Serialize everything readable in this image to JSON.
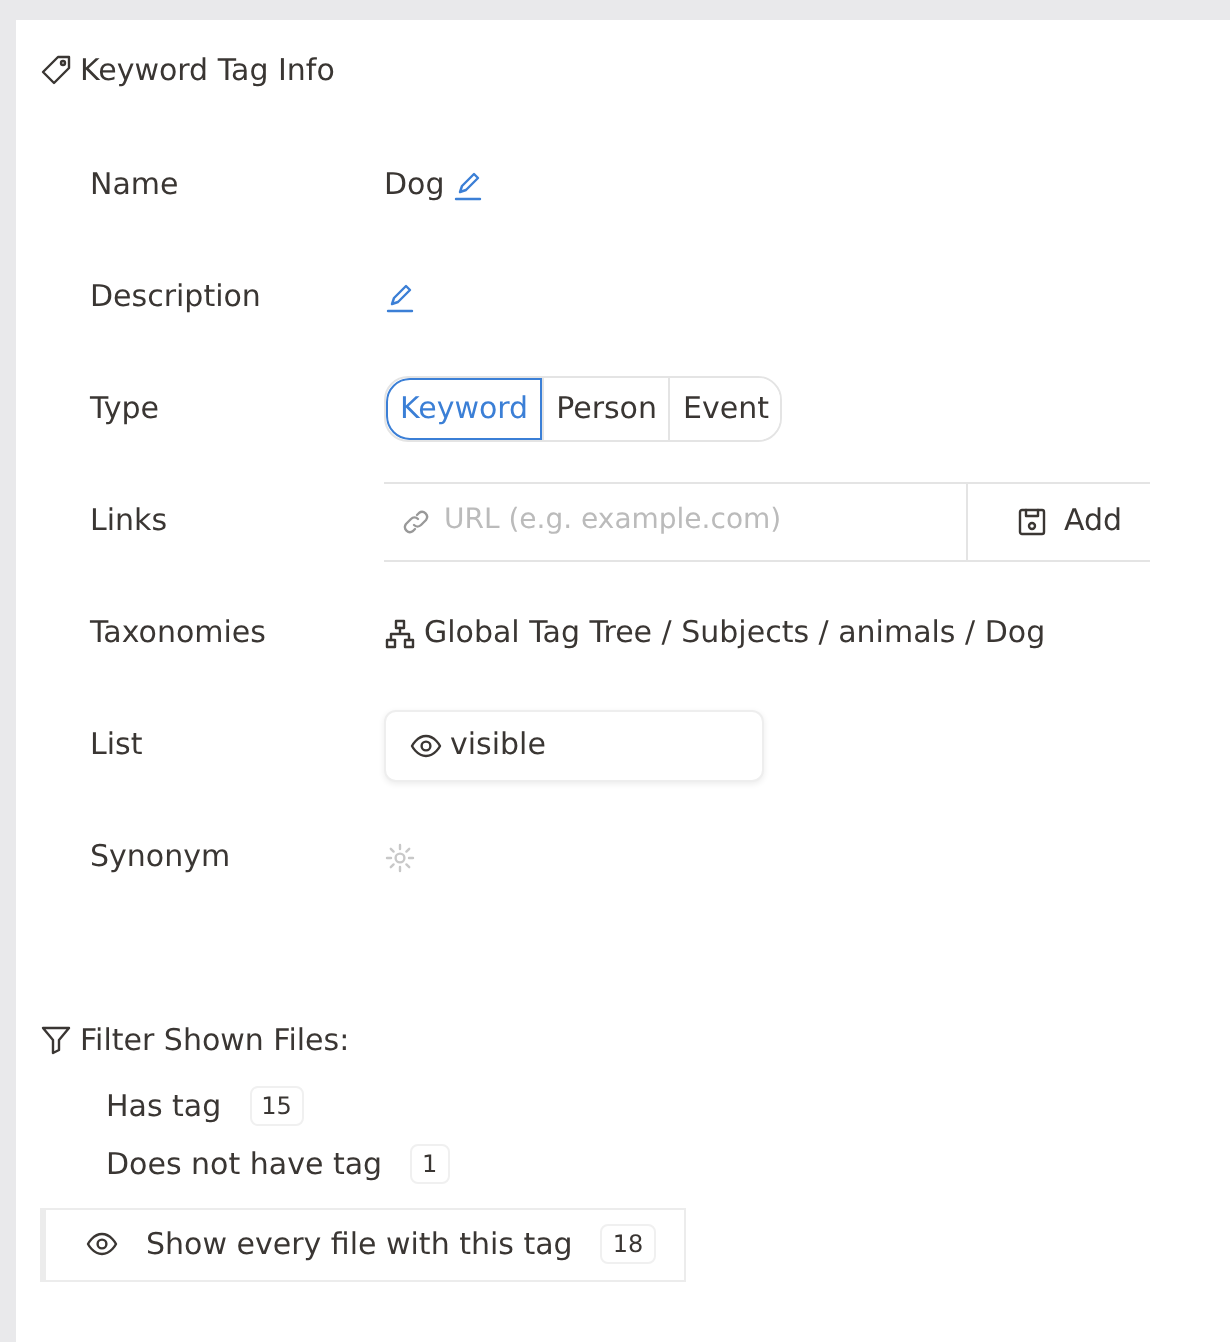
{
  "panel": {
    "title": "Keyword Tag Info"
  },
  "fields": [
    {
      "kind": "text",
      "label": "Name",
      "value": "Dog"
    },
    {
      "kind": "text",
      "label": "Description"
    },
    {
      "kind": "segments",
      "label": "Type",
      "options": [
        {
          "label": "Keyword",
          "selected": true
        },
        {
          "label": "Person",
          "selected": false
        },
        {
          "label": "Event",
          "selected": false
        }
      ]
    },
    {
      "kind": "url",
      "label": "Links",
      "placeholder": "URL (e.g. example.com)",
      "button": "Add"
    },
    {
      "kind": "path",
      "label": "Taxonomies",
      "value": "Global Tag Tree / Subjects / animals / Dog"
    },
    {
      "kind": "select",
      "label": "List",
      "value": "visible"
    },
    {
      "kind": "settings",
      "label": "Synonym"
    }
  ],
  "filter": {
    "title": "Filter Shown Files:",
    "options": [
      {
        "label": "Has tag",
        "count": "15",
        "selected": false
      },
      {
        "label": "Does not have tag",
        "count": "1",
        "selected": false
      },
      {
        "label": "Show every file with this tag",
        "count": "18",
        "selected": true
      }
    ]
  }
}
